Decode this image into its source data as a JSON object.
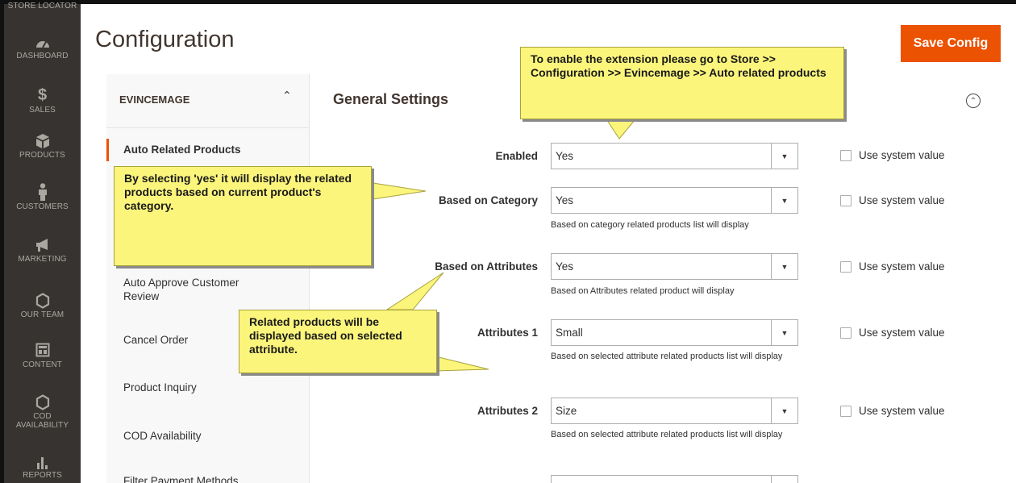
{
  "sidebar": {
    "items": [
      {
        "label": "Store Locator",
        "icon": "store-locator-icon"
      },
      {
        "label": "Dashboard",
        "icon": "dashboard-icon"
      },
      {
        "label": "Sales",
        "icon": "dollar-icon"
      },
      {
        "label": "Products",
        "icon": "box-icon"
      },
      {
        "label": "Customers",
        "icon": "person-icon"
      },
      {
        "label": "Marketing",
        "icon": "megaphone-icon"
      },
      {
        "label": "Our Team",
        "icon": "hexagon-icon"
      },
      {
        "label": "Content",
        "icon": "layout-icon"
      },
      {
        "label": "COD Availability",
        "icon": "hexagon-icon"
      },
      {
        "label": "Reports",
        "icon": "bar-chart-icon"
      }
    ]
  },
  "header": {
    "title": "Configuration",
    "save_label": "Save Config",
    "accent": "#eb5202"
  },
  "tabs": {
    "heading": "EVINCEMAGE",
    "items": [
      {
        "label": "Auto Related Products",
        "active": true
      },
      {
        "label": "Auto Approve Customer Review"
      },
      {
        "label": "Cancel Order"
      },
      {
        "label": "Product Inquiry"
      },
      {
        "label": "COD Availability"
      },
      {
        "label": "Filter Payment Methods"
      }
    ]
  },
  "settings": {
    "section_title": "General Settings",
    "system_value_label": "Use system value",
    "rows": [
      {
        "label": "Enabled",
        "value": "Yes",
        "note": ""
      },
      {
        "label": "Based on Category",
        "value": "Yes",
        "note": "Based on category related products list will display"
      },
      {
        "label": "Based on Attributes",
        "value": "Yes",
        "note": "Based on Attributes related product will display"
      },
      {
        "label": "Attributes 1",
        "value": "Small",
        "note": "Based on selected attribute related products list will display"
      },
      {
        "label": "Attributes 2",
        "value": "Size",
        "note": "Based on selected attribute related products list will display"
      }
    ]
  },
  "callouts": {
    "top": "To enable the extension please go to Store >> Configuration >> Evincemage >> Auto related products",
    "left": "By selecting 'yes' it will display the related products based on current product's category.",
    "middle": "Related products will be displayed based on selected attribute.",
    "color": "#fbf57c"
  }
}
